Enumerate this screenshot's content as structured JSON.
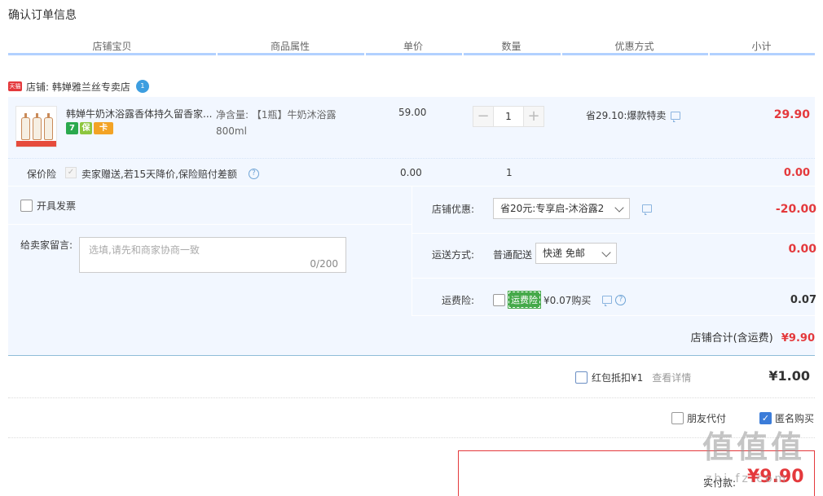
{
  "page_title": "确认订单信息",
  "columns": [
    "店铺宝贝",
    "商品属性",
    "单价",
    "数量",
    "优惠方式",
    "小计"
  ],
  "shop": {
    "badge": "天猫",
    "label": "店铺: 韩婵雅兰丝专卖店",
    "ww_icon": "chat-bubble-icon"
  },
  "item": {
    "name": "韩婵牛奶沐浴露香体持久留香家...",
    "attr": "净含量: 【1瓶】牛奶沐浴露800ml",
    "price": "59.00",
    "quantity": "1",
    "minus": "−",
    "plus": "+",
    "discount": "省29.10:爆款特卖",
    "subtotal": "29.90",
    "mini_icons": [
      "7",
      "保",
      "卡"
    ],
    "mini_colors": [
      "#2ba94e",
      "#8dc63f",
      "#f3a325"
    ]
  },
  "insurance": {
    "label": "保价险",
    "check": "✓",
    "text": "卖家赠送,若15天降价,保险赔付差额",
    "help": "?",
    "price": "0.00",
    "qty": "1",
    "subtotal": "0.00"
  },
  "invoice": {
    "label": "开具发票"
  },
  "remark": {
    "label": "给卖家留言:",
    "placeholder": "选填,请先和商家协商一致",
    "count": "0/200"
  },
  "shop_discount": {
    "label": "店铺优惠:",
    "selected": "省20元:专享启-沐浴露2",
    "value": "-20.00"
  },
  "shipping": {
    "label": "运送方式:",
    "type": "普通配送",
    "selected": "快递 免邮",
    "value": "0.00"
  },
  "freight_insurance": {
    "label": "运费险:",
    "badge": "运费险",
    "text": "¥0.07购买",
    "help": "?",
    "value": "0.07"
  },
  "shop_total": {
    "label": "店铺合计(含运费)",
    "value": "¥9.90"
  },
  "red_packet": {
    "label": "红包抵扣¥1",
    "link": "查看详情",
    "amount": "¥1.00"
  },
  "friend_pay": {
    "label": "朋友代付"
  },
  "anonymous": {
    "label": "匿名购买",
    "check": "✓"
  },
  "payment": {
    "label": "实付款:",
    "amount": "¥9.90"
  },
  "watermark": {
    "text": "值值值",
    "sub": "zhi.fz.com"
  },
  "colors": {
    "accent_blue": "#b2d1ff",
    "price_red": "#e4393c",
    "row_bg": "#f2f7ff"
  }
}
